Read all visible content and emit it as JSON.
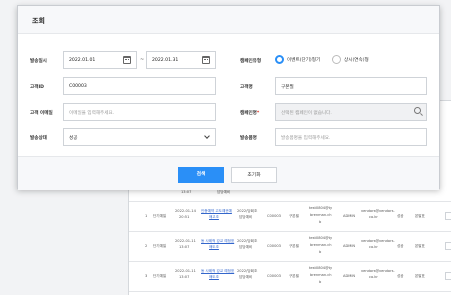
{
  "modal": {
    "title": "조회",
    "left": {
      "ship_date_label": "발송일시",
      "date_from": "2022.01.01",
      "date_to": "2022.01.31",
      "date_separator": "~",
      "customer_id_label": "고객ID",
      "customer_id": "C00003",
      "customer_email_label": "고객 이메일",
      "customer_email_placeholder": "이메일을 입력해주세요.",
      "send_status_label": "발송상태",
      "send_status_value": "성공"
    },
    "right": {
      "campaign_type_label": "캠페인유형",
      "campaign_type_options": [
        "이벤트(단기)형기",
        "상시(연속)형"
      ],
      "campaign_type_selected": 0,
      "customer_name_label": "고객명",
      "customer_name": "구본필",
      "campaign_label": "캠페인명",
      "campaign_required": "*",
      "campaign_placeholder": "선택된 캠페인이 없습니다.",
      "send_template_label": "발송폼명",
      "send_template_placeholder": "발송폼명을 입력해주세요."
    },
    "buttons": {
      "search": "검색",
      "reset": "초기화"
    }
  },
  "background_table": {
    "partial_row": {
      "time": "13:07",
      "sender": "담당예비"
    },
    "rows": [
      {
        "no": "1",
        "type": "단기예일",
        "date": "2022-01-14",
        "time": "20:51",
        "link1": "인증예약 고도예권예",
        "link2": "매고조",
        "sender1": "2022/당회조",
        "sender2": "담당예비",
        "id": "C00003",
        "name": "구본필",
        "email1": "test0804@ty",
        "email2": "brenman.ch",
        "email3": "b",
        "code": "ADMIN",
        "vendor1": "vendors@vendors.",
        "vendor2": "co.kr",
        "status": "성공",
        "view": "본발표"
      },
      {
        "no": "2",
        "type": "단기예일",
        "date": "2022-01-11",
        "time": "13:07",
        "link1": "동 사례적 강교 예정표",
        "link2": "매도조",
        "sender1": "2022/당회조",
        "sender2": "담당예비",
        "id": "C00003",
        "name": "구본필",
        "email1": "test0804@ty",
        "email2": "brenman.ch",
        "email3": "b",
        "code": "ADMIN",
        "vendor1": "vendors@vendors.",
        "vendor2": "co.kr",
        "status": "성공",
        "view": "본발표"
      },
      {
        "no": "3",
        "type": "단기예일",
        "date": "2022-01-11",
        "time": "13:07",
        "link1": "동 사례적 강교 예정표",
        "link2": "매도조",
        "sender1": "2022/당회조",
        "sender2": "담당예비",
        "id": "C00003",
        "name": "구본필",
        "email1": "test0804@ty",
        "email2": "brenman.ch",
        "email3": "b",
        "code": "ADMIN",
        "vendor1": "vendors@vendors.",
        "vendor2": "co.kr",
        "status": "성공",
        "view": "본발표"
      }
    ]
  }
}
